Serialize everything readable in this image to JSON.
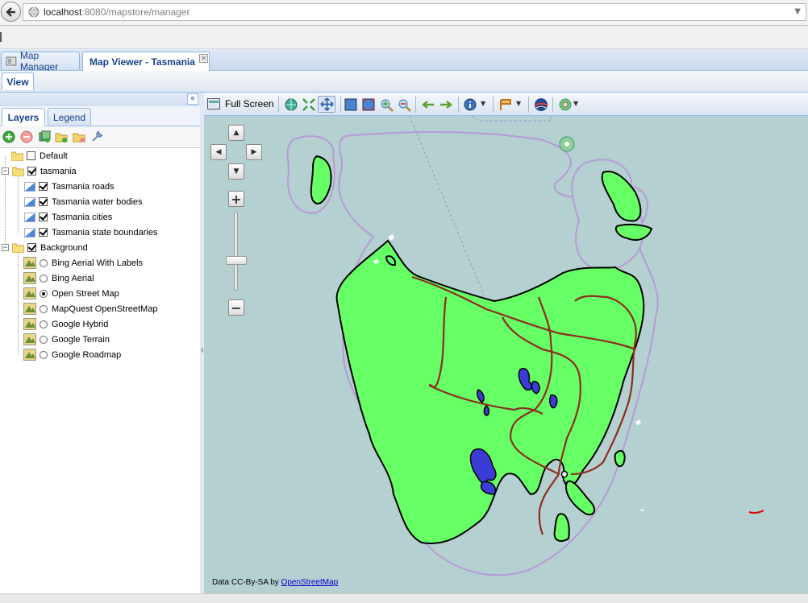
{
  "browser": {
    "url_host": "localhost",
    "url_rest": ":8080/mapstore/manager"
  },
  "app_tabs": [
    {
      "label": "Map Manager"
    },
    {
      "label": "Map Viewer - Tasmania"
    }
  ],
  "view_button": "View",
  "left_panel": {
    "tabs": [
      "Layers",
      "Legend"
    ],
    "tree": {
      "default_group": "Default",
      "tasmania_group": "tasmania",
      "tasmania_layers": [
        "Tasmania roads",
        "Tasmania water bodies",
        "Tasmania cities",
        "Tasmania state boundaries"
      ],
      "background_group": "Background",
      "background_layers": [
        "Bing Aerial With Labels",
        "Bing Aerial",
        "Open Street Map",
        "MapQuest OpenStreetMap",
        "Google Hybrid",
        "Google Terrain",
        "Google Roadmap"
      ],
      "selected_background": "Open Street Map"
    }
  },
  "map_toolbar": {
    "full_screen": "Full Screen"
  },
  "map": {
    "attribution_prefix": "Data CC-By-SA by",
    "attribution_link": "OpenStreetMap",
    "colors": {
      "sea": "#b5d0d0",
      "land": "#66ff66",
      "roads": "#8b2e1e",
      "water": "#3b3bd6",
      "boundary": "#b89ad6"
    }
  }
}
